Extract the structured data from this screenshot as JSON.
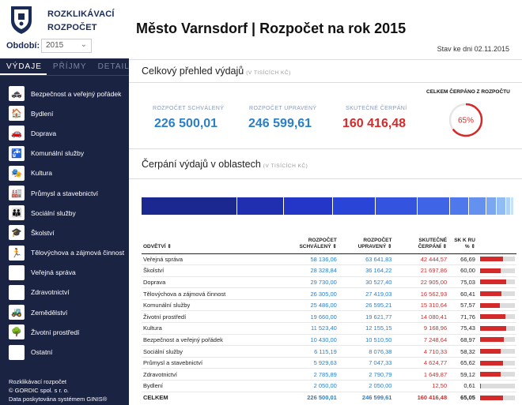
{
  "brand": {
    "line1": "ROZKLIKÁVACÍ",
    "line2": "ROZPOČET"
  },
  "period": {
    "label": "Období:",
    "value": "2015"
  },
  "title": "Město Varnsdorf | Rozpočet na rok 2015",
  "state_date": "Stav ke dni 02.11.2015",
  "tabs": [
    "VÝDAJE",
    "PŘÍJMY",
    "DETAIL"
  ],
  "menu": [
    {
      "label": "Bezpečnost a veřejný pořádek",
      "icon": "police-icon",
      "glyph": "🚓"
    },
    {
      "label": "Bydlení",
      "icon": "house-icon",
      "glyph": "🏠"
    },
    {
      "label": "Doprava",
      "icon": "car-icon",
      "glyph": "🚗"
    },
    {
      "label": "Komunální služby",
      "icon": "tap-icon",
      "glyph": "🚰"
    },
    {
      "label": "Kultura",
      "icon": "theatre-icon",
      "glyph": "🎭"
    },
    {
      "label": "Průmysl a stavebnictví",
      "icon": "factory-icon",
      "glyph": "🏭"
    },
    {
      "label": "Sociální služby",
      "icon": "people-icon",
      "glyph": "👪"
    },
    {
      "label": "Školství",
      "icon": "graduation-cap-icon",
      "glyph": "🎓"
    },
    {
      "label": "Tělovýchova a zájmová činnost",
      "icon": "sport-icon",
      "glyph": "🏃"
    },
    {
      "label": "Veřejná správa",
      "icon": "town-hall-icon",
      "glyph": "🏛"
    },
    {
      "label": "Zdravotnictví",
      "icon": "health-icon",
      "glyph": "❤"
    },
    {
      "label": "Zemědělství",
      "icon": "tractor-icon",
      "glyph": "🚜"
    },
    {
      "label": "Životní prostředí",
      "icon": "tree-icon",
      "glyph": "🌳"
    },
    {
      "label": "Ostatní",
      "icon": "other-icon",
      "glyph": "⚙"
    }
  ],
  "footer": {
    "line1": "Rozklikávací rozpočet",
    "line2": "© GORDIC spol. s r. o.",
    "line3": "Data poskytována systémem GINIS®"
  },
  "overview": {
    "title": "Celkový přehled výdajů",
    "unit": "(V TISÍCÍCH KČ)",
    "schvaleny_label": "ROZPOČET SCHVÁLENÝ",
    "schvaleny": "226 500,01",
    "upraveny_label": "ROZPOČET UPRAVENÝ",
    "upraveny": "246 599,61",
    "skutecne_label": "SKUTEČNÉ ČERPÁNÍ",
    "skutecne": "160 416,48",
    "pct_label": "CELKEM ČERPÁNO Z ROZPOČTU",
    "pct_text": "65%",
    "pct_value": 0.65
  },
  "areas": {
    "title": "Čerpání výdajů v oblastech",
    "unit": "(V TISÍCÍCH KČ)",
    "stack": [
      {
        "share": 58136.06,
        "color": "#1b2890"
      },
      {
        "share": 28328.84,
        "color": "#1f2fb0"
      },
      {
        "share": 29730.0,
        "color": "#2436c8"
      },
      {
        "share": 26305.0,
        "color": "#2b44d8"
      },
      {
        "share": 25486.0,
        "color": "#3454e0"
      },
      {
        "share": 19660.0,
        "color": "#3f64e6"
      },
      {
        "share": 11523.4,
        "color": "#4f78ec"
      },
      {
        "share": 10430.0,
        "color": "#6490f0"
      },
      {
        "share": 6115.19,
        "color": "#7aa6f2"
      },
      {
        "share": 5929.63,
        "color": "#92bcf4"
      },
      {
        "share": 2785.89,
        "color": "#aed2f6"
      },
      {
        "share": 2050.0,
        "color": "#c8e2f8"
      }
    ],
    "headers": {
      "name": "ODVĚTVÍ",
      "schv": "ROZPOČET SCHVÁLENÝ",
      "upr": "ROZPOČET UPRAVENÝ",
      "skut": "SKUTEČNÉ ČERPÁNÍ",
      "pct": "SK K RU %"
    },
    "rows": [
      {
        "name": "Veřejná správa",
        "schv": "58 136,06",
        "upr": "63 641,83",
        "skut": "42 444,57",
        "pct": "66,69",
        "pv": 66.69
      },
      {
        "name": "Školství",
        "schv": "28 328,84",
        "upr": "36 164,22",
        "skut": "21 697,86",
        "pct": "60,00",
        "pv": 60.0
      },
      {
        "name": "Doprava",
        "schv": "29 730,00",
        "upr": "30 527,40",
        "skut": "22 905,00",
        "pct": "75,03",
        "pv": 75.03
      },
      {
        "name": "Tělovýchova a zájmová činnost",
        "schv": "26 305,00",
        "upr": "27 419,03",
        "skut": "16 562,93",
        "pct": "60,41",
        "pv": 60.41
      },
      {
        "name": "Komunální služby",
        "schv": "25 486,00",
        "upr": "26 595,21",
        "skut": "15 310,64",
        "pct": "57,57",
        "pv": 57.57
      },
      {
        "name": "Životní prostředí",
        "schv": "19 660,00",
        "upr": "19 621,77",
        "skut": "14 080,41",
        "pct": "71,76",
        "pv": 71.76
      },
      {
        "name": "Kultura",
        "schv": "11 523,40",
        "upr": "12 155,15",
        "skut": "9 168,96",
        "pct": "75,43",
        "pv": 75.43
      },
      {
        "name": "Bezpečnost a veřejný pořádek",
        "schv": "10 430,00",
        "upr": "10 510,50",
        "skut": "7 248,64",
        "pct": "68,97",
        "pv": 68.97
      },
      {
        "name": "Sociální služby",
        "schv": "6 115,19",
        "upr": "8 076,38",
        "skut": "4 710,33",
        "pct": "58,32",
        "pv": 58.32
      },
      {
        "name": "Průmysl a stavebnictví",
        "schv": "5 929,63",
        "upr": "7 047,33",
        "skut": "4 624,77",
        "pct": "65,62",
        "pv": 65.62
      },
      {
        "name": "Zdravotnictví",
        "schv": "2 785,89",
        "upr": "2 790,79",
        "skut": "1 649,87",
        "pct": "59,12",
        "pv": 59.12
      },
      {
        "name": "Bydlení",
        "schv": "2 050,00",
        "upr": "2 050,00",
        "skut": "12,50",
        "pct": "0,61",
        "pv": 0.61
      }
    ],
    "total": {
      "name": "CELKEM",
      "schv": "226 500,01",
      "upr": "246 599,61",
      "skut": "160 416,48",
      "pct": "65,05",
      "pv": 65.05
    }
  }
}
